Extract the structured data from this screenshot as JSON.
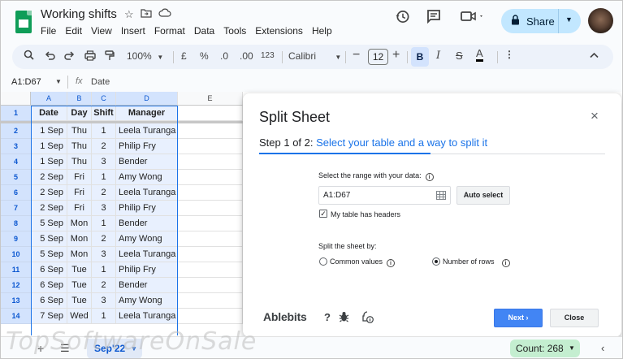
{
  "app": {
    "doc_title": "Working shifts",
    "menu": [
      "File",
      "Edit",
      "View",
      "Insert",
      "Format",
      "Data",
      "Tools",
      "Extensions",
      "Help"
    ],
    "share_label": "Share"
  },
  "toolbar": {
    "zoom": "100%",
    "currency": "£",
    "percent": "%",
    "decrease_decimal": ".0",
    "increase_decimal": ".00",
    "number_format": "123",
    "font_name": "Calibri",
    "font_size": "12",
    "bold": "B",
    "italic": "I",
    "strike": "S",
    "text_color": "A"
  },
  "formula_bar": {
    "name_box": "A1:D67",
    "fx": "fx",
    "value": "Date"
  },
  "grid": {
    "columns": [
      "A",
      "B",
      "C",
      "D",
      "E"
    ],
    "header_row": {
      "num": "1",
      "cells": [
        "Date",
        "Day",
        "Shift",
        "Manager"
      ]
    },
    "rows": [
      {
        "num": "2",
        "cells": [
          "1 Sep",
          "Thu",
          "1",
          "Leela Turanga"
        ]
      },
      {
        "num": "3",
        "cells": [
          "1 Sep",
          "Thu",
          "2",
          "Philip Fry"
        ]
      },
      {
        "num": "4",
        "cells": [
          "1 Sep",
          "Thu",
          "3",
          "Bender"
        ]
      },
      {
        "num": "5",
        "cells": [
          "2 Sep",
          "Fri",
          "1",
          "Amy Wong"
        ]
      },
      {
        "num": "6",
        "cells": [
          "2 Sep",
          "Fri",
          "2",
          "Leela Turanga"
        ]
      },
      {
        "num": "7",
        "cells": [
          "2 Sep",
          "Fri",
          "3",
          "Philip Fry"
        ]
      },
      {
        "num": "8",
        "cells": [
          "5 Sep",
          "Mon",
          "1",
          "Bender"
        ]
      },
      {
        "num": "9",
        "cells": [
          "5 Sep",
          "Mon",
          "2",
          "Amy Wong"
        ]
      },
      {
        "num": "10",
        "cells": [
          "5 Sep",
          "Mon",
          "3",
          "Leela Turanga"
        ]
      },
      {
        "num": "11",
        "cells": [
          "6 Sep",
          "Tue",
          "1",
          "Philip Fry"
        ]
      },
      {
        "num": "12",
        "cells": [
          "6 Sep",
          "Tue",
          "2",
          "Bender"
        ]
      },
      {
        "num": "13",
        "cells": [
          "6 Sep",
          "Tue",
          "3",
          "Amy Wong"
        ]
      },
      {
        "num": "14",
        "cells": [
          "7 Sep",
          "Wed",
          "1",
          "Leela Turanga"
        ]
      }
    ]
  },
  "dialog": {
    "title": "Split Sheet",
    "close": "×",
    "step_label": "Step 1 of 2:",
    "step_desc": "Select your table and a way to split it",
    "range_label": "Select the range with your data:",
    "range_value": "A1:D67",
    "auto_select": "Auto select",
    "headers_label": "My table has headers",
    "headers_checked": true,
    "split_by_label": "Split the sheet by:",
    "option_common": "Common values",
    "option_rows": "Number of rows",
    "selected_option": "rows",
    "brand": "Ablebits",
    "help": "?",
    "next": "Next ›",
    "close_btn": "Close"
  },
  "bottom": {
    "sheet_tab": "Sep'22",
    "count": "Count: 268",
    "watermark": "TopSoftwareOnSale"
  }
}
